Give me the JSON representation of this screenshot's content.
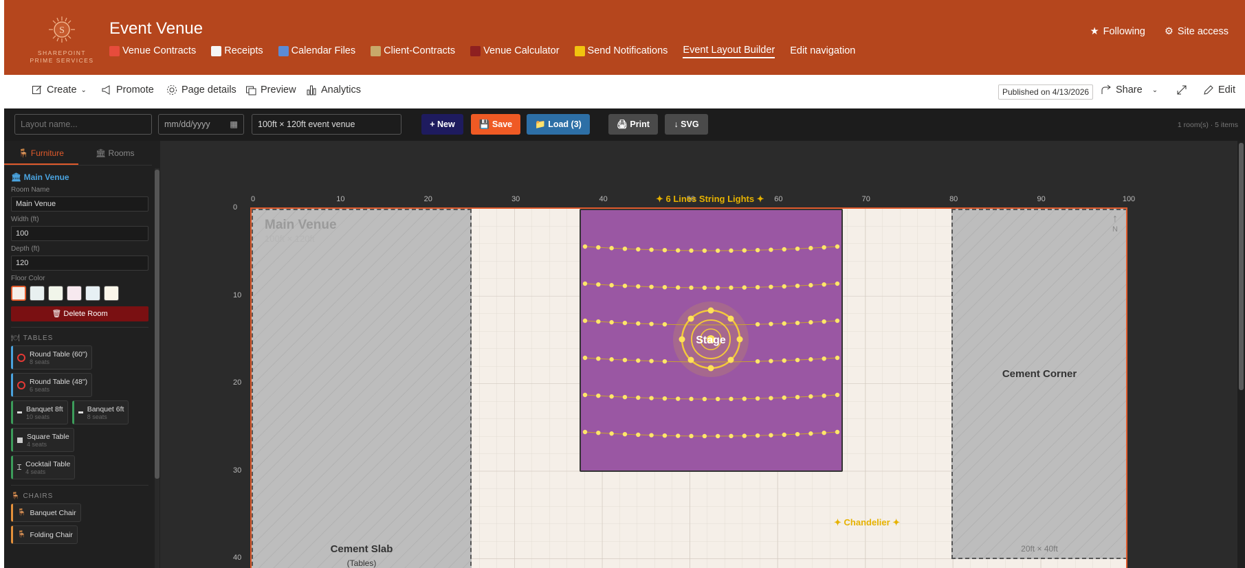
{
  "header": {
    "logo_letter": "S",
    "logo_line1": "SHAREPOINT",
    "logo_line2": "PRIME SERVICES",
    "site_title": "Event Venue",
    "nav": [
      {
        "label": "Venue Contracts",
        "icon": "ribbon-icon",
        "color": "#e74c3c"
      },
      {
        "label": "Receipts",
        "icon": "receipt-icon",
        "color": "#f5f5f5"
      },
      {
        "label": "Calendar Files",
        "icon": "calendar-icon",
        "color": "#5b8bd6"
      },
      {
        "label": "Client-Contracts",
        "icon": "scroll-icon",
        "color": "#c8a96a"
      },
      {
        "label": "Venue Calculator",
        "icon": "abacus-icon",
        "color": "#8e2020"
      },
      {
        "label": "Send Notifications",
        "icon": "bell-icon",
        "color": "#f1c40f"
      },
      {
        "label": "Event Layout Builder",
        "icon": "",
        "color": "",
        "active": true
      },
      {
        "label": "Edit navigation",
        "icon": "",
        "color": ""
      }
    ],
    "following": "Following",
    "site_access": "Site access"
  },
  "commandbar": {
    "create": "Create",
    "promote": "Promote",
    "page_details": "Page details",
    "preview": "Preview",
    "analytics": "Analytics",
    "published": "Published on 4/13/2026",
    "share": "Share",
    "edit": "Edit"
  },
  "toolbar": {
    "layout_name_placeholder": "Layout name...",
    "date_placeholder": "mm/dd/yyyy",
    "venue_desc": "100ft × 120ft event venue",
    "new": "+ New",
    "save": "💾 Save",
    "load": "📁 Load (3)",
    "print": "🖨 Print",
    "svg": "↓ SVG",
    "status": "1 room(s) · 5 items",
    "colors": {
      "new": "#1e1b5e",
      "save": "#ef5a24",
      "load": "#2d6fa6",
      "gray": "#4a4a4a"
    }
  },
  "sidebar": {
    "tabs": [
      "🪑 Furniture",
      "🏛 Rooms"
    ],
    "room_title": "🏛 Main Venue",
    "room_name_label": "Room Name",
    "room_name": "Main Venue",
    "width_label": "Width (ft)",
    "width": "100",
    "depth_label": "Depth (ft)",
    "depth": "120",
    "floor_color_label": "Floor Color",
    "floor_colors": [
      "#f5efe8",
      "#e8f0f0",
      "#f1f5ea",
      "#f7e9ef",
      "#e7f0f4",
      "#fbf6ea"
    ],
    "delete_room": "🗑 Delete Room",
    "tables_header": "TABLES",
    "tables": [
      {
        "name": "Round Table (60\")",
        "seats": "8 seats",
        "icon": "round-table-icon"
      },
      {
        "name": "Round Table (48\")",
        "seats": "6 seats",
        "icon": "round-table-icon"
      },
      {
        "name": "Banquet 8ft",
        "seats": "10 seats",
        "icon": "banquet-table-icon"
      },
      {
        "name": "Banquet 6ft",
        "seats": "8 seats",
        "icon": "banquet-table-icon"
      },
      {
        "name": "Square Table",
        "seats": "4 seats",
        "icon": "square-table-icon"
      },
      {
        "name": "Cocktail Table",
        "seats": "4 seats",
        "icon": "cocktail-table-icon"
      }
    ],
    "chairs_header": "CHAIRS",
    "chairs": [
      "Banquet Chair",
      "Folding Chair"
    ]
  },
  "canvas": {
    "ruler_x": [
      "0",
      "10",
      "20",
      "30",
      "40",
      "50",
      "60",
      "70",
      "80",
      "90",
      "100"
    ],
    "ruler_y": [
      "0",
      "10",
      "20",
      "30",
      "40"
    ],
    "room_label": "Main Venue",
    "room_size": "100ft × 120ft",
    "north": "N",
    "string_lights": "✦ 6 Lines String Lights ✦",
    "stage_label": "Stage",
    "chandelier": "✦ Chandelier ✦",
    "cement_slab": "Cement Slab",
    "cement_slab_sub": "(Tables)",
    "cement_corner": "Cement Corner",
    "cement_corner_size": "20ft × 40ft"
  }
}
